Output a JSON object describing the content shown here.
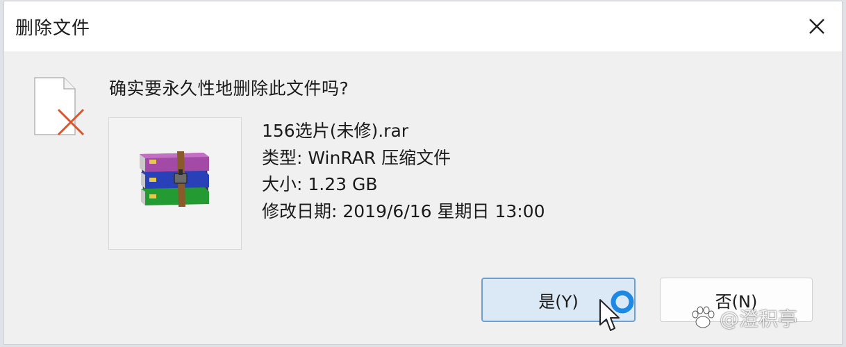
{
  "dialog": {
    "title": "删除文件",
    "question": "确实要永久性地删除此文件吗?"
  },
  "file": {
    "name": "156选片(未修).rar",
    "type_line": "类型: WinRAR 压缩文件",
    "size_line": "大小: 1.23 GB",
    "modified_line": "修改日期: 2019/6/16 星期日 13:00"
  },
  "buttons": {
    "yes_label": "是(Y)",
    "no_label": "否(N)"
  },
  "watermark": {
    "text": "@澄积亭"
  },
  "icons": {
    "close": "close-icon",
    "delete_file": "file-delete-icon",
    "archive": "winrar-archive-icon",
    "busy": "busy-spinner-icon",
    "cursor": "mouse-pointer-icon"
  },
  "colors": {
    "dialog_bg": "#f0f0f0",
    "titlebar_bg": "#ffffff",
    "yes_bg": "#dbe8f6",
    "yes_border": "#6d9fd1",
    "delete_x": "#d9532b",
    "spinner": "#1e88e5"
  }
}
